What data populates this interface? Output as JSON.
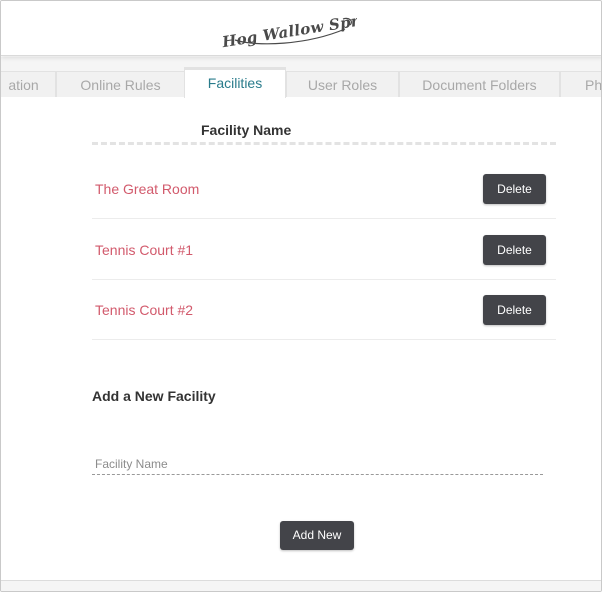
{
  "brand": {
    "logo_text": "Hog Wallow Springs"
  },
  "tabs": [
    {
      "label": "ation",
      "active": false
    },
    {
      "label": "Online Rules",
      "active": false
    },
    {
      "label": "Facilities",
      "active": true
    },
    {
      "label": "User Roles",
      "active": false
    },
    {
      "label": "Document Folders",
      "active": false
    },
    {
      "label": "Pho",
      "active": false
    }
  ],
  "facilities": {
    "column_header": "Facility Name",
    "items": [
      {
        "name": "The Great Room",
        "action": "Delete"
      },
      {
        "name": "Tennis Court #1",
        "action": "Delete"
      },
      {
        "name": "Tennis Court #2",
        "action": "Delete"
      }
    ]
  },
  "add_form": {
    "title": "Add a New Facility",
    "placeholder": "Facility Name",
    "value": "",
    "button_label": "Add New"
  },
  "colors": {
    "link": "#d25a6c",
    "button_bg": "#434449",
    "tab_active_text": "#2a7c8c",
    "tab_inactive_text": "#a8a8a8"
  }
}
